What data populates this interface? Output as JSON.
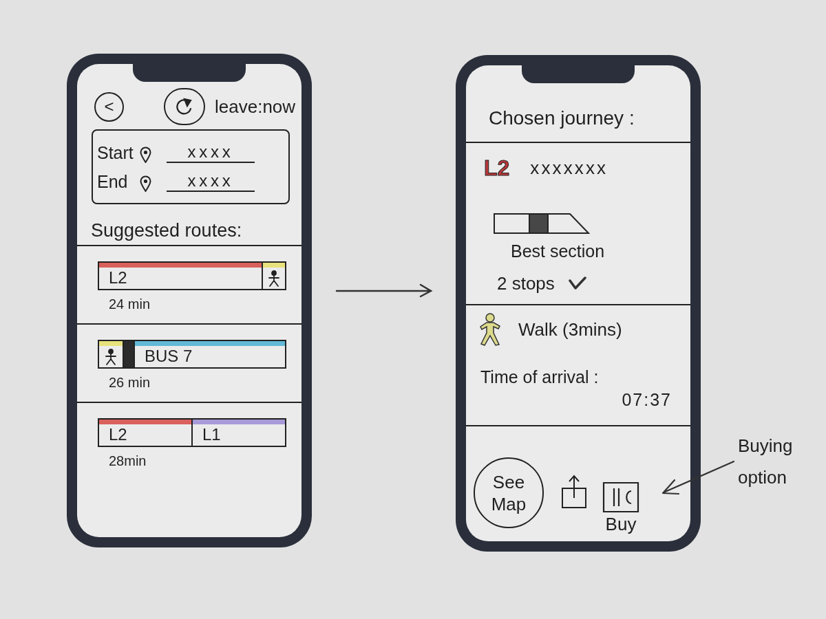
{
  "suggestions_screen": {
    "header": {
      "back": "<",
      "leave": "leave:now"
    },
    "trip_fields": [
      {
        "label": "Start",
        "value": "xxxx"
      },
      {
        "label": "End",
        "value": "xxxx"
      }
    ],
    "title": "Suggested routes:",
    "routes": [
      {
        "segments": [
          {
            "kind": "line",
            "label": "L2",
            "color": "#d9605c"
          },
          {
            "kind": "walk",
            "color": "#e8e27c"
          }
        ],
        "duration": "24 min"
      },
      {
        "segments": [
          {
            "kind": "walk",
            "color": "#e8e27c"
          },
          {
            "kind": "wait"
          },
          {
            "kind": "line",
            "label": "BUS 7",
            "color": "#62b9d6"
          }
        ],
        "duration": "26 min"
      },
      {
        "segments": [
          {
            "kind": "line",
            "label": "L2",
            "color": "#d9605c"
          },
          {
            "kind": "line",
            "label": "L1",
            "color": "#a89ad8"
          }
        ],
        "duration": "28min"
      }
    ]
  },
  "journey_screen": {
    "title": "Chosen journey :",
    "leg": {
      "line": "L2",
      "detail": "xxxxxxx",
      "section_label": "Best section",
      "stops": "2 stops"
    },
    "walk": {
      "label": "Walk (3mins)"
    },
    "arrival": {
      "label": "Time of arrival :",
      "time": "07:37"
    },
    "actions": [
      {
        "kind": "circle",
        "label": "See Map"
      },
      {
        "kind": "share"
      },
      {
        "kind": "buy",
        "label": "Buy"
      }
    ]
  },
  "annotation": {
    "text": "Buying option"
  }
}
